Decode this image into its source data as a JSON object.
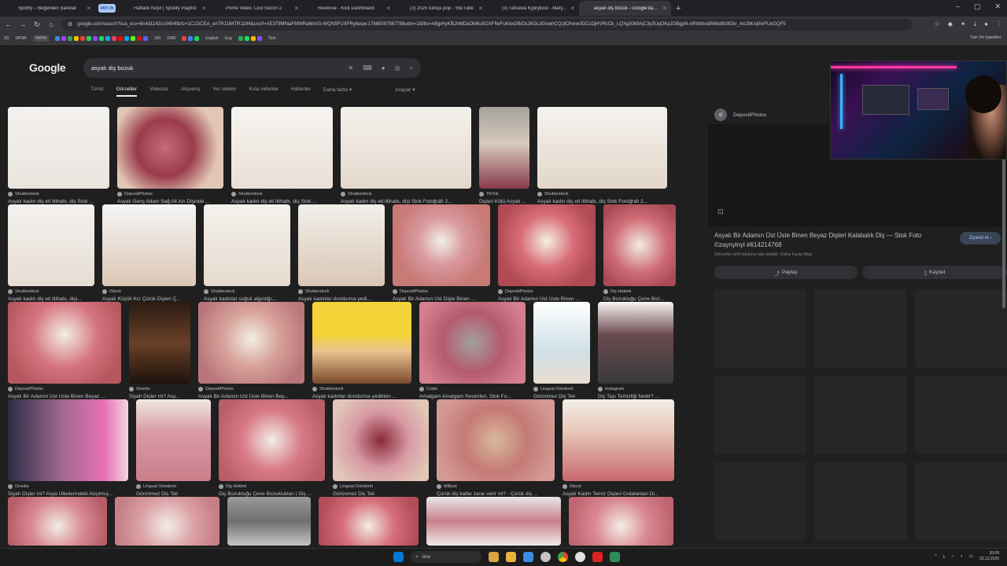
{
  "browser": {
    "tabs": [
      {
        "title": "Spotify – Beğenilen Şarkılar",
        "color": "#1ed760"
      },
      {
        "title": "Haftalık Keşif | Spotify Playlist",
        "color": "#1ed760"
      },
      {
        "title": "Prime Video: Lost Sezon 2",
        "color": "#1a98ff"
      },
      {
        "title": "Revenue - Kick Dashboard",
        "color": "#53fc18"
      },
      {
        "title": "(3) 2025 türkçe pop - YouTube",
        "color": "#ff0000"
      },
      {
        "title": "(3) Tatsuwa Kyprykost - Mary...",
        "color": "#ff0000"
      },
      {
        "title": "asyalı diş bozuk - Google'da Ar",
        "color": "#4285f4"
      }
    ],
    "pinned_tab": "PAYLIN",
    "address": "google.com/search?sca_esv=8c4d1142cc0454f&rlz=1C1GCEA_enTR1194TR1194&sxsrf=AE3TifMNiaF6fWRaMmGI-WQN5FUXFRyboqw:17665097967788udm=2&fbs=ABjpHyKf5JhMDaOM6u5OXFNvFuKbxDBiOsJKGLdGnwhCQzjlOhxrw0DCcDjHVRcCb_LQXg3069AjC3y3UqOKpJOBgpN-ARtWdxIdNMa9fz9Gtv_Aio3tKrqIhnFUxGQF5",
    "bookmarks": [
      "3D",
      "SPOR",
      "YAYIN",
      "English",
      "Eng",
      "Türk",
      "Tüm Yer İşaretleri"
    ],
    "bookmark_numbers": [
      "100",
      "1000"
    ]
  },
  "google": {
    "logo": "Google",
    "query": "asyalı diş bozuk",
    "tabs": [
      "Tümü",
      "Görseller",
      "Videolar",
      "Alışveriş",
      "Yer siteleri",
      "Kısa videolar",
      "Haberler",
      "Daha fazla"
    ],
    "active_tab": "Görseller",
    "tools": "Araçlar"
  },
  "results": [
    [
      {
        "src": "Shutterstock",
        "cap": "Asyalı kadın diş eti iltihabı, diş Stok ...",
        "bg": "linear-gradient(180deg,#f3f1ee 0%,#eae4de 100%)"
      },
      {
        "src": "DepositPhotos",
        "cap": "Asyalı Genç Adam Sağ Alt Azı Dişinde ...",
        "bg": "radial-gradient(circle at 45% 50%,#c56a7a 0%,#9a3b4b 40%,#e2c7b5 75%)"
      },
      {
        "src": "Shutterstock",
        "cap": "Asyalı kadın diş eti iltihabı, diş Stok ...",
        "bg": "linear-gradient(180deg,#f7f4f1 0%,#e9dfd6 100%)"
      },
      {
        "src": "Shutterstock",
        "cap": "Asyalı kadın diş eti iltihabı, dişi Stok Fotoğrafı 2...",
        "bg": "linear-gradient(180deg,#f4f1ec 0%,#e3d8cd 100%)"
      },
      {
        "src": "TikTok",
        "cap": "Dişleri Kötü Asyalı ...",
        "bg": "linear-gradient(180deg,#a5a29b 0%,#d6c9bd 45%,#8a3a4a 100%)"
      },
      {
        "src": "Shutterstock",
        "cap": "Asyalı kadın diş eti iltihabı, diş Stok Fotoğrafı 2...",
        "bg": "linear-gradient(180deg,#f5f2ee 0%,#e2d6ca 100%)"
      }
    ],
    [
      {
        "src": "Shutterstock",
        "cap": "Asyalı kadın diş eti iltihabı, dişi...",
        "bg": "linear-gradient(180deg,#f3f1ee 0%,#e6ddd3 100%)"
      },
      {
        "src": "iStock",
        "cap": "Asyalı Küçük Kız Çürük Dişleri Ç...",
        "bg": "linear-gradient(180deg,#f5f5f5 0%,#dcc7b4 100%)"
      },
      {
        "src": "Shutterstock",
        "cap": "Asyalı kadınlar soğuk algınlığı,...",
        "bg": "linear-gradient(180deg,#f4f1ec 0%,#e5dacf 100%)"
      },
      {
        "src": "Shutterstock",
        "cap": "Asyalı kadınlar dondurma yedi...",
        "bg": "linear-gradient(180deg,#f2efea 0%,#d9c7b5 100%)"
      },
      {
        "src": "DepositPhotos",
        "cap": "Asyalı Bir Adamın Üst Dişte Binen ...",
        "bg": "radial-gradient(circle at 50% 45%,#f2efe6 0%,#d99aa0 35%,#c87a76 70%)"
      },
      {
        "src": "DepositPhotos",
        "cap": "Asyalı Bir Adamın Üst Üste Binen ...",
        "bg": "radial-gradient(circle at 50% 45%,#f5f0e0 0%,#d86d78 40%,#b04a55 75%)"
      },
      {
        "src": "Diş Hekimi",
        "cap": "Diş Bozukluğu Çene Boz...",
        "bg": "radial-gradient(circle at 50% 50%,#f2ebe2 0%,#cf6d76 50%,#a84a55 85%)"
      }
    ],
    [
      {
        "src": "DepositPhotos",
        "cap": "Asyalı Bir Adamın Üst Üste Binen Beyaz ...",
        "bg": "radial-gradient(circle at 50% 40%,#f3ede4 0%,#d4737d 45%,#b6575f 80%)"
      },
      {
        "src": "Onedio",
        "cap": "Siyah Dişler mi? Asy...",
        "bg": "linear-gradient(180deg,#2a1b12 0%,#6a4028 50%,#1e130c 100%)"
      },
      {
        "src": "DepositPhotos",
        "cap": "Asyalı Bir Adamın Üst Üste Binen Bey...",
        "bg": "radial-gradient(circle at 50% 45%,#f3efe4 0%,#d7a29a 40%,#b9767a 80%)"
      },
      {
        "src": "Shutterstock",
        "cap": "Asyalı kadınlar dondurma yedikten ...",
        "bg": "linear-gradient(180deg,#f4d23a 0%,#f5d437 40%,#e9c28f 60%,#7a4a2e 100%)"
      },
      {
        "src": "Cralio",
        "cap": "Amalgam Amalgam Resimleri, Stok Fo...",
        "bg": "radial-gradient(circle at 50% 50%,#a3a0a0 0%,#b45b6e 45%,#d48090 85%)"
      },
      {
        "src": "Lingual Ortodonti",
        "cap": "Görünmez Diş Teli",
        "bg": "linear-gradient(180deg,#ffffff 0%,#cfe0e8 60%,#e9dccf 100%)"
      },
      {
        "src": "Instagram",
        "cap": "Diş Taşı Temizliği Nedir? ...",
        "bg": "linear-gradient(180deg,#f8f6f3 0%,#6a4a50 40%,#3a3a3a 100%)"
      }
    ],
    [
      {
        "src": "Onedio",
        "cap": "Siyah Dişler mi? Asya Ülkelerindeki Alışılmış...",
        "bg": "linear-gradient(90deg,#2c2c46 0%,#a06a8e 45%,#e86fb7 80%,#f4d6dc 100%)"
      },
      {
        "src": "Lingual Ortodonti",
        "cap": "Görünmez Diş Teli",
        "bg": "linear-gradient(180deg,#efe8e3 0%,#d99aa6 40%,#c97f8a 100%)"
      },
      {
        "src": "Diş Hekimi",
        "cap": "Diş Bozukluğu Çene Bozuklukları | Diş ...",
        "bg": "radial-gradient(circle at 50% 50%,#f3ede6 0%,#d87a86 45%,#b75e69 85%)"
      },
      {
        "src": "Lingual Ortodonti",
        "cap": "Görünmez Diş Teli",
        "bg": "radial-gradient(circle at 50% 50%,#8a2a3a 0%,#d79aa4 45%,#e2c7b8 85%)"
      },
      {
        "src": "Milliyet",
        "cap": "Çürük diş kalbe zarar verir mi? - Çürük diş ...",
        "bg": "radial-gradient(circle at 50% 50%,#d9b89a 0%,#c47a76 45%,#d49a94 85%)"
      },
      {
        "src": "iStock",
        "cap": "Asyalı Kadın Temiz Dişleri Gıdalardan Di...",
        "bg": "linear-gradient(180deg,#f2eee8 0%,#e7c6b8 40%,#c86870 100%)"
      }
    ]
  ],
  "bottom_row": [
    {
      "bg": "radial-gradient(circle at 50% 60%,#f2ece3 0%,#d98a94 45%,#b75d68 85%)"
    },
    {
      "bg": "radial-gradient(circle at 50% 60%,#f3eee6 0%,#dba1a6 45%,#c47f85 85%)"
    },
    {
      "bg": "linear-gradient(180deg,#9a9a9a 0%,#6f6f6f 50%,#c5c5c5 100%)"
    },
    {
      "bg": "radial-gradient(circle at 50% 60%,#f2ece2 0%,#d76e7a 45%,#b14c58 85%)"
    },
    {
      "bg": "linear-gradient(180deg,#e7e7e7 0%,#c97f8a 50%,#f0eaea 100%)"
    },
    {
      "bg": "radial-gradient(circle at 50% 60%,#f4eee5 0%,#d98792 45%,#bf6570 85%)"
    }
  ],
  "panel": {
    "source": "DepositPhotos",
    "source_initial": "d",
    "title": "Asyalı Bir Adamın Üst Üste Binen Beyaz Dişleri Kalabalık Diş — Stok Foto ©zaynylnyl #614214768",
    "visit_label": "Ziyaret et",
    "sub": "Görseller telif hakkına tabi olabilir. Daha Fazla Bilgi",
    "share_label": "Paylaş",
    "save_label": "Kaydet"
  },
  "taskbar": {
    "search_label": "Ara",
    "time": "20:09",
    "date": "23.12.2025",
    "icon_colors": [
      "#0078d4",
      "#d9a441",
      "#3a8ee6",
      "#c4c4c4",
      "#1ed760",
      "#e0e0e0",
      "#d22",
      "#2e8b57"
    ]
  }
}
